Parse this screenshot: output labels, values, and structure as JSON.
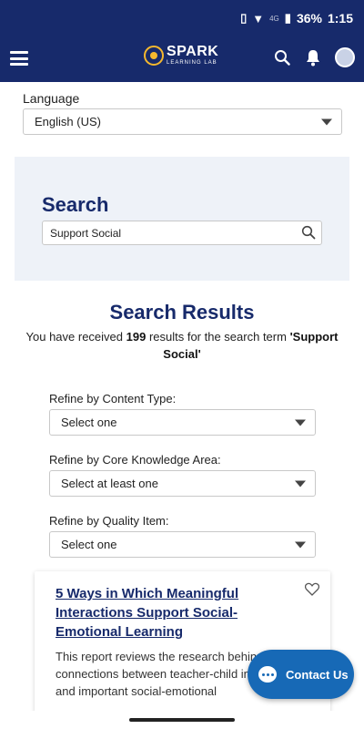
{
  "status": {
    "signal_label": "4G",
    "battery": "36%",
    "time": "1:15"
  },
  "app": {
    "logo_text": "SPARK",
    "logo_sub": "LEARNING LAB",
    "icons": [
      "menu-icon",
      "search-icon",
      "bell-icon",
      "avatar"
    ]
  },
  "language": {
    "label": "Language",
    "selected": "English (US)"
  },
  "search": {
    "title": "Search",
    "value": "Support Social"
  },
  "results": {
    "title": "Search Results",
    "prefix": "You have received ",
    "count": "199",
    "middle": " results for the search term ",
    "term": "'Support Social'"
  },
  "refine": [
    {
      "label": "Refine by Content Type:",
      "selected": "Select one"
    },
    {
      "label": "Refine by Core Knowledge Area:",
      "selected": "Select at least one"
    },
    {
      "label": "Refine by Quality Item:",
      "selected": "Select one"
    }
  ],
  "card": {
    "title": "5 Ways in Which Meaningful Interactions Support Social-Emotional Learning",
    "description": "This report reviews the research behind connections between teacher-child interactions and important social-emotional"
  },
  "contact": {
    "label": "Contact Us"
  },
  "colors": {
    "brand": "#172a6b",
    "accent": "#1769b6",
    "logo_gold": "#f5b82e"
  }
}
